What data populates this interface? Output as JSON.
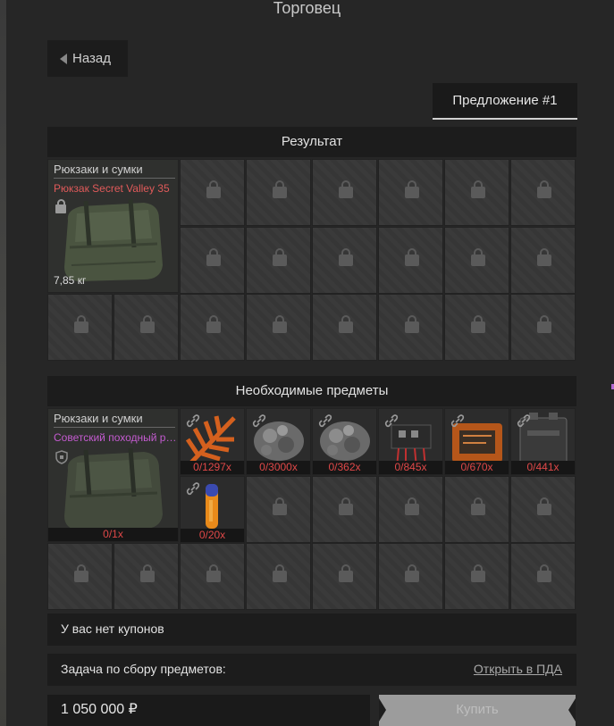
{
  "header": {
    "title": "Торговец"
  },
  "back_button": {
    "label": "Назад"
  },
  "offer_tab": {
    "label": "Предложение #1"
  },
  "result": {
    "header": "Результат",
    "item": {
      "category": "Рюкзаки и сумки",
      "name": "Рюкзак Secret Valley 35",
      "name_color": "#e05a5a",
      "weight": "7,85 кг"
    }
  },
  "required": {
    "header": "Необходимые предметы",
    "main_item": {
      "category": "Рюкзаки и сумки",
      "name": "Советский походный рю..",
      "name_color": "#c45bd0",
      "count": "0/1x"
    },
    "items": [
      {
        "icon": "fern-icon",
        "count": "0/1297x"
      },
      {
        "icon": "ore-icon",
        "count": "0/3000x"
      },
      {
        "icon": "ore-icon",
        "count": "0/362x"
      },
      {
        "icon": "circuit-icon",
        "count": "0/845x"
      },
      {
        "icon": "device-icon",
        "count": "0/670x"
      },
      {
        "icon": "battery-icon",
        "count": "0/441x"
      },
      {
        "icon": "vial-icon",
        "count": "0/20x"
      }
    ]
  },
  "coupons": {
    "text": "У вас нет купонов"
  },
  "task": {
    "label": "Задача по сбору предметов:",
    "link": "Открыть в ПДА"
  },
  "purchase": {
    "price": "1 050 000 ₽",
    "buy_label": "Купить"
  }
}
